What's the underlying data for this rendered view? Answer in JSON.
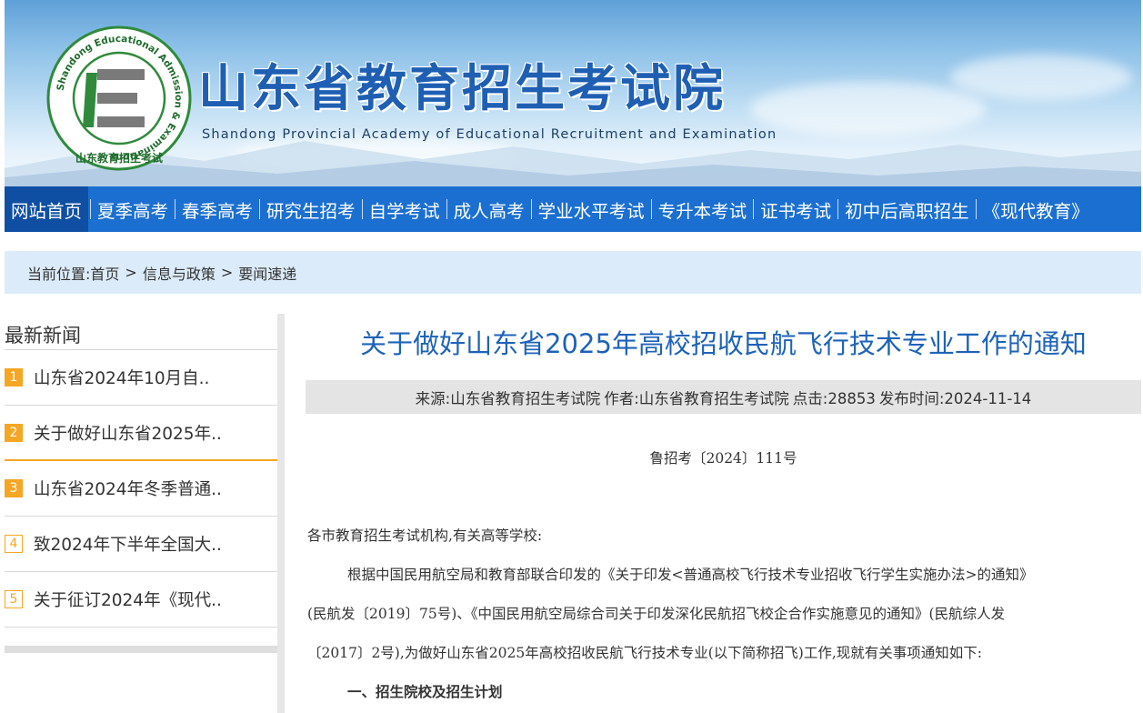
{
  "header": {
    "title": "山东省教育招生考试院",
    "subtitle": "Shandong Provincial Academy of Educational Recruitment and Examination",
    "logo_ring_text": "Shandong Educational Admission & Examinations",
    "logo_cn_text": "山东教育招生考试"
  },
  "nav": {
    "items": [
      {
        "label": "网站首页",
        "active": true
      },
      {
        "label": "夏季高考"
      },
      {
        "label": "春季高考"
      },
      {
        "label": "研究生招考"
      },
      {
        "label": "自学考试"
      },
      {
        "label": "成人高考"
      },
      {
        "label": "学业水平考试"
      },
      {
        "label": "专升本考试"
      },
      {
        "label": "证书考试"
      },
      {
        "label": "初中后高职招生"
      },
      {
        "label": "《现代教育》"
      }
    ]
  },
  "breadcrumb": {
    "prefix": "当前位置:",
    "items": [
      "首页",
      "信息与政策",
      "要闻速递"
    ],
    "separator": ">"
  },
  "sidebar": {
    "title": "最新新闻",
    "items": [
      {
        "num": "1",
        "text": "山东省2024年10月自.."
      },
      {
        "num": "2",
        "text": "关于做好山东省2025年.."
      },
      {
        "num": "3",
        "text": "山东省2024年冬季普通.."
      },
      {
        "num": "4",
        "text": "致2024年下半年全国大.."
      },
      {
        "num": "5",
        "text": "关于征订2024年《现代.."
      }
    ]
  },
  "article": {
    "title": "关于做好山东省2025年高校招收民航飞行技术专业工作的通知",
    "meta": {
      "source": "来源:山东省教育招生考试院",
      "author": "作者:山东省教育招生考试院",
      "clicks": "点击:28853",
      "published": "发布时间:2024-11-14"
    },
    "doc_number": "鲁招考〔2024〕111号",
    "salutation": "各市教育招生考试机构,有关高等学校:",
    "para1_line1": "根据中国民用航空局和教育部联合印发的《关于印发<普通高校飞行技术专业招收飞行学生实施办法>的通知》",
    "para1_line2": "(民航发〔2019〕75号)、《中国民用航空局综合司关于印发深化民航招飞校企合作实施意见的通知》(民航综人发",
    "para1_line3": "〔2017〕2号),为做好山东省2025年高校招收民航飞行技术专业(以下简称招飞)工作,现就有关事项通知如下:",
    "section1": "一、招生院校及招生计划"
  },
  "colors": {
    "nav_bg": "#1b6fd1",
    "nav_active_bg": "#0e4fa3",
    "title_blue": "#1e63b8",
    "badge_orange": "#f5a623",
    "crumb_bg": "#dcebf9",
    "meta_bg": "#e4e4e4"
  }
}
